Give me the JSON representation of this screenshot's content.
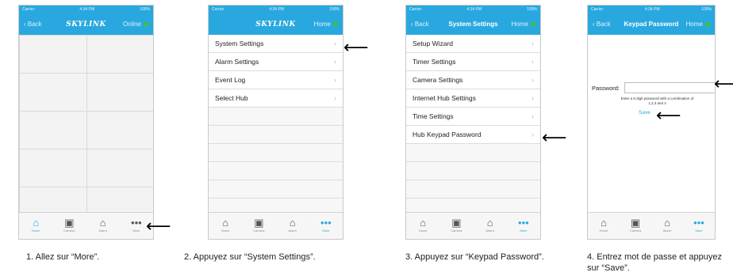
{
  "status": {
    "carrier": "Carrier",
    "time": "4:34 PM",
    "battery": "100%"
  },
  "tabs": [
    {
      "label": "Home",
      "icon": "home-icon",
      "glyph": "⌂"
    },
    {
      "label": "Camera",
      "icon": "camera-icon",
      "glyph": "▣"
    },
    {
      "label": "Alarm",
      "icon": "alarm-icon",
      "glyph": "⌂"
    },
    {
      "label": "More",
      "icon": "more-icon",
      "glyph": "•••"
    }
  ],
  "screen1": {
    "back": "Back",
    "logo": "SKYLINK",
    "status": "Online"
  },
  "screen2": {
    "logo": "SKYLINK",
    "home": "Home",
    "items": [
      "System Settings",
      "Alarm Settings",
      "Event Log",
      "Select Hub"
    ]
  },
  "screen3": {
    "back": "Back",
    "title": "System Settings",
    "home": "Home",
    "items": [
      "Setup Wizard",
      "Timer Settings",
      "Camera Settings",
      "Internet Hub Settings",
      "Time Settings",
      "Hub Keypad Password"
    ]
  },
  "screen4": {
    "back": "Back",
    "title": "Keypad Password",
    "home": "Home",
    "password_label": "Password:",
    "hint": "Enter a 8 digit password with a combination of 1,2,3 and 4",
    "save": "Save"
  },
  "captions": [
    "1. Allez sur “More”.",
    "2. Appuyez sur “System Settings”.",
    "3. Appuyez sur “Keypad Password”.",
    "4. Entrez mot de passe et appuyez sur “Save”."
  ],
  "arrow_glyph": "⟵",
  "colors": {
    "accent": "#29a8e0",
    "online": "#3ec23e"
  }
}
